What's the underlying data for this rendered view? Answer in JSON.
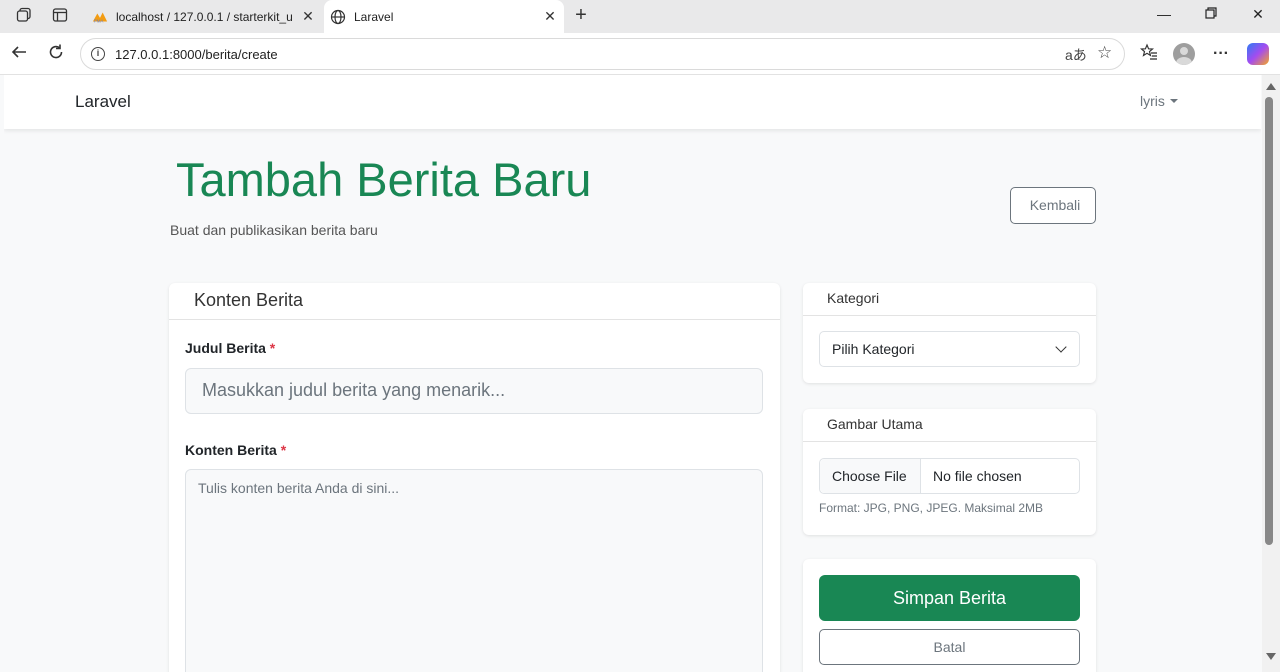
{
  "browser": {
    "tabs": [
      {
        "label": "localhost / 127.0.0.1 / starterkit_u",
        "active": false,
        "favicon": "phpmyadmin-icon"
      },
      {
        "label": "Laravel",
        "active": true,
        "favicon": "globe-icon"
      }
    ],
    "url": "127.0.0.1:8000/berita/create"
  },
  "navbar": {
    "brand": "Laravel",
    "user": "lyris"
  },
  "header": {
    "title": "Tambah Berita Baru",
    "subtitle": "Buat dan publikasikan berita baru",
    "back_label": "Kembali"
  },
  "form": {
    "card_title": "Konten Berita",
    "title_label": "Judul Berita",
    "title_placeholder": "Masukkan judul berita yang menarik...",
    "content_label": "Konten Berita",
    "content_placeholder": "Tulis konten berita Anda di sini...",
    "required_mark": "*"
  },
  "sidebar": {
    "category_title": "Kategori",
    "category_selected": "Pilih Kategori",
    "image_title": "Gambar Utama",
    "file_button": "Choose File",
    "file_status": "No file chosen",
    "file_help": "Format: JPG, PNG, JPEG. Maksimal 2MB",
    "save_label": "Simpan Berita",
    "cancel_label": "Batal"
  },
  "colors": {
    "primary": "#198754",
    "danger": "#dc3545",
    "secondary": "#6c757d"
  }
}
